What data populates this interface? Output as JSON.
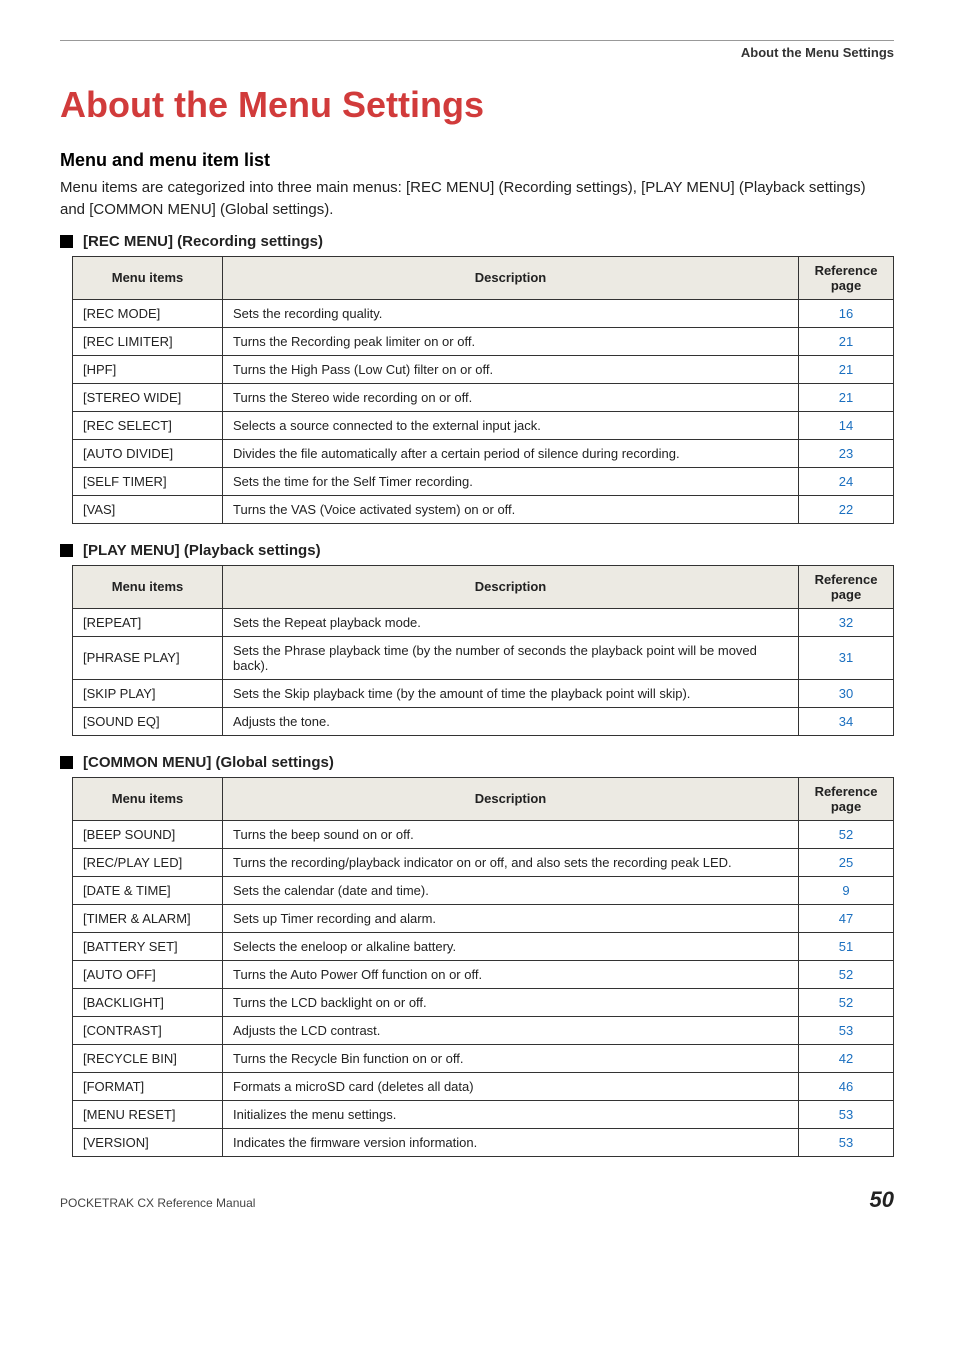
{
  "header_runner": "About the Menu Settings",
  "title": "About the Menu Settings",
  "section_heading": "Menu and menu item list",
  "intro_text": "Menu items are categorized into three main menus: [REC MENU] (Recording settings), [PLAY MENU] (Playback settings) and [COMMON MENU] (Global settings).",
  "tables": [
    {
      "caption": "[REC MENU] (Recording settings)",
      "headers": [
        "Menu items",
        "Description",
        "Reference page"
      ],
      "rows": [
        {
          "item": "[REC MODE]",
          "desc": "Sets the recording quality.",
          "ref": "16"
        },
        {
          "item": "[REC LIMITER]",
          "desc": "Turns the Recording peak limiter on or off.",
          "ref": "21"
        },
        {
          "item": "[HPF]",
          "desc": "Turns the High Pass (Low Cut) filter on or off.",
          "ref": "21"
        },
        {
          "item": "[STEREO WIDE]",
          "desc": "Turns the Stereo wide recording on or off.",
          "ref": "21"
        },
        {
          "item": "[REC SELECT]",
          "desc": "Selects a source connected to the external input jack.",
          "ref": "14"
        },
        {
          "item": "[AUTO DIVIDE]",
          "desc": "Divides the file automatically after a certain period of silence during recording.",
          "ref": "23"
        },
        {
          "item": "[SELF TIMER]",
          "desc": "Sets the time for the Self Timer recording.",
          "ref": "24"
        },
        {
          "item": "[VAS]",
          "desc": "Turns the VAS (Voice activated system) on or off.",
          "ref": "22"
        }
      ]
    },
    {
      "caption": "[PLAY MENU] (Playback settings)",
      "headers": [
        "Menu items",
        "Description",
        "Reference page"
      ],
      "rows": [
        {
          "item": "[REPEAT]",
          "desc": "Sets the Repeat playback mode.",
          "ref": "32"
        },
        {
          "item": "[PHRASE PLAY]",
          "desc": "Sets the Phrase playback time (by the number of seconds the playback point will be moved back).",
          "ref": "31"
        },
        {
          "item": "[SKIP PLAY]",
          "desc": "Sets the Skip playback time (by the amount of time the playback point will skip).",
          "ref": "30"
        },
        {
          "item": "[SOUND EQ]",
          "desc": "Adjusts the tone.",
          "ref": "34"
        }
      ]
    },
    {
      "caption": "[COMMON MENU] (Global settings)",
      "headers": [
        "Menu items",
        "Description",
        "Reference page"
      ],
      "rows": [
        {
          "item": "[BEEP SOUND]",
          "desc": "Turns the beep sound on or off.",
          "ref": "52"
        },
        {
          "item": "[REC/PLAY LED]",
          "desc": "Turns the recording/playback indicator on or off, and also sets the recording peak LED.",
          "ref": "25"
        },
        {
          "item": "[DATE & TIME]",
          "desc": "Sets the calendar (date and time).",
          "ref": "9"
        },
        {
          "item": "[TIMER & ALARM]",
          "desc": "Sets up Timer recording and alarm.",
          "ref": "47"
        },
        {
          "item": "[BATTERY SET]",
          "desc": "Selects the eneloop or alkaline battery.",
          "ref": "51"
        },
        {
          "item": "[AUTO OFF]",
          "desc": "Turns the Auto Power Off function on or off.",
          "ref": "52"
        },
        {
          "item": "[BACKLIGHT]",
          "desc": "Turns the LCD backlight on or off.",
          "ref": "52"
        },
        {
          "item": "[CONTRAST]",
          "desc": "Adjusts the LCD contrast.",
          "ref": "53"
        },
        {
          "item": "[RECYCLE BIN]",
          "desc": "Turns the Recycle Bin function on or off.",
          "ref": "42"
        },
        {
          "item": "[FORMAT]",
          "desc": "Formats a microSD card (deletes all data)",
          "ref": "46"
        },
        {
          "item": "[MENU RESET]",
          "desc": "Initializes the menu settings.",
          "ref": "53"
        },
        {
          "item": "[VERSION]",
          "desc": "Indicates the firmware version information.",
          "ref": "53"
        }
      ]
    }
  ],
  "footer": {
    "left": "POCKETRAK CX   Reference Manual",
    "right": "50"
  }
}
